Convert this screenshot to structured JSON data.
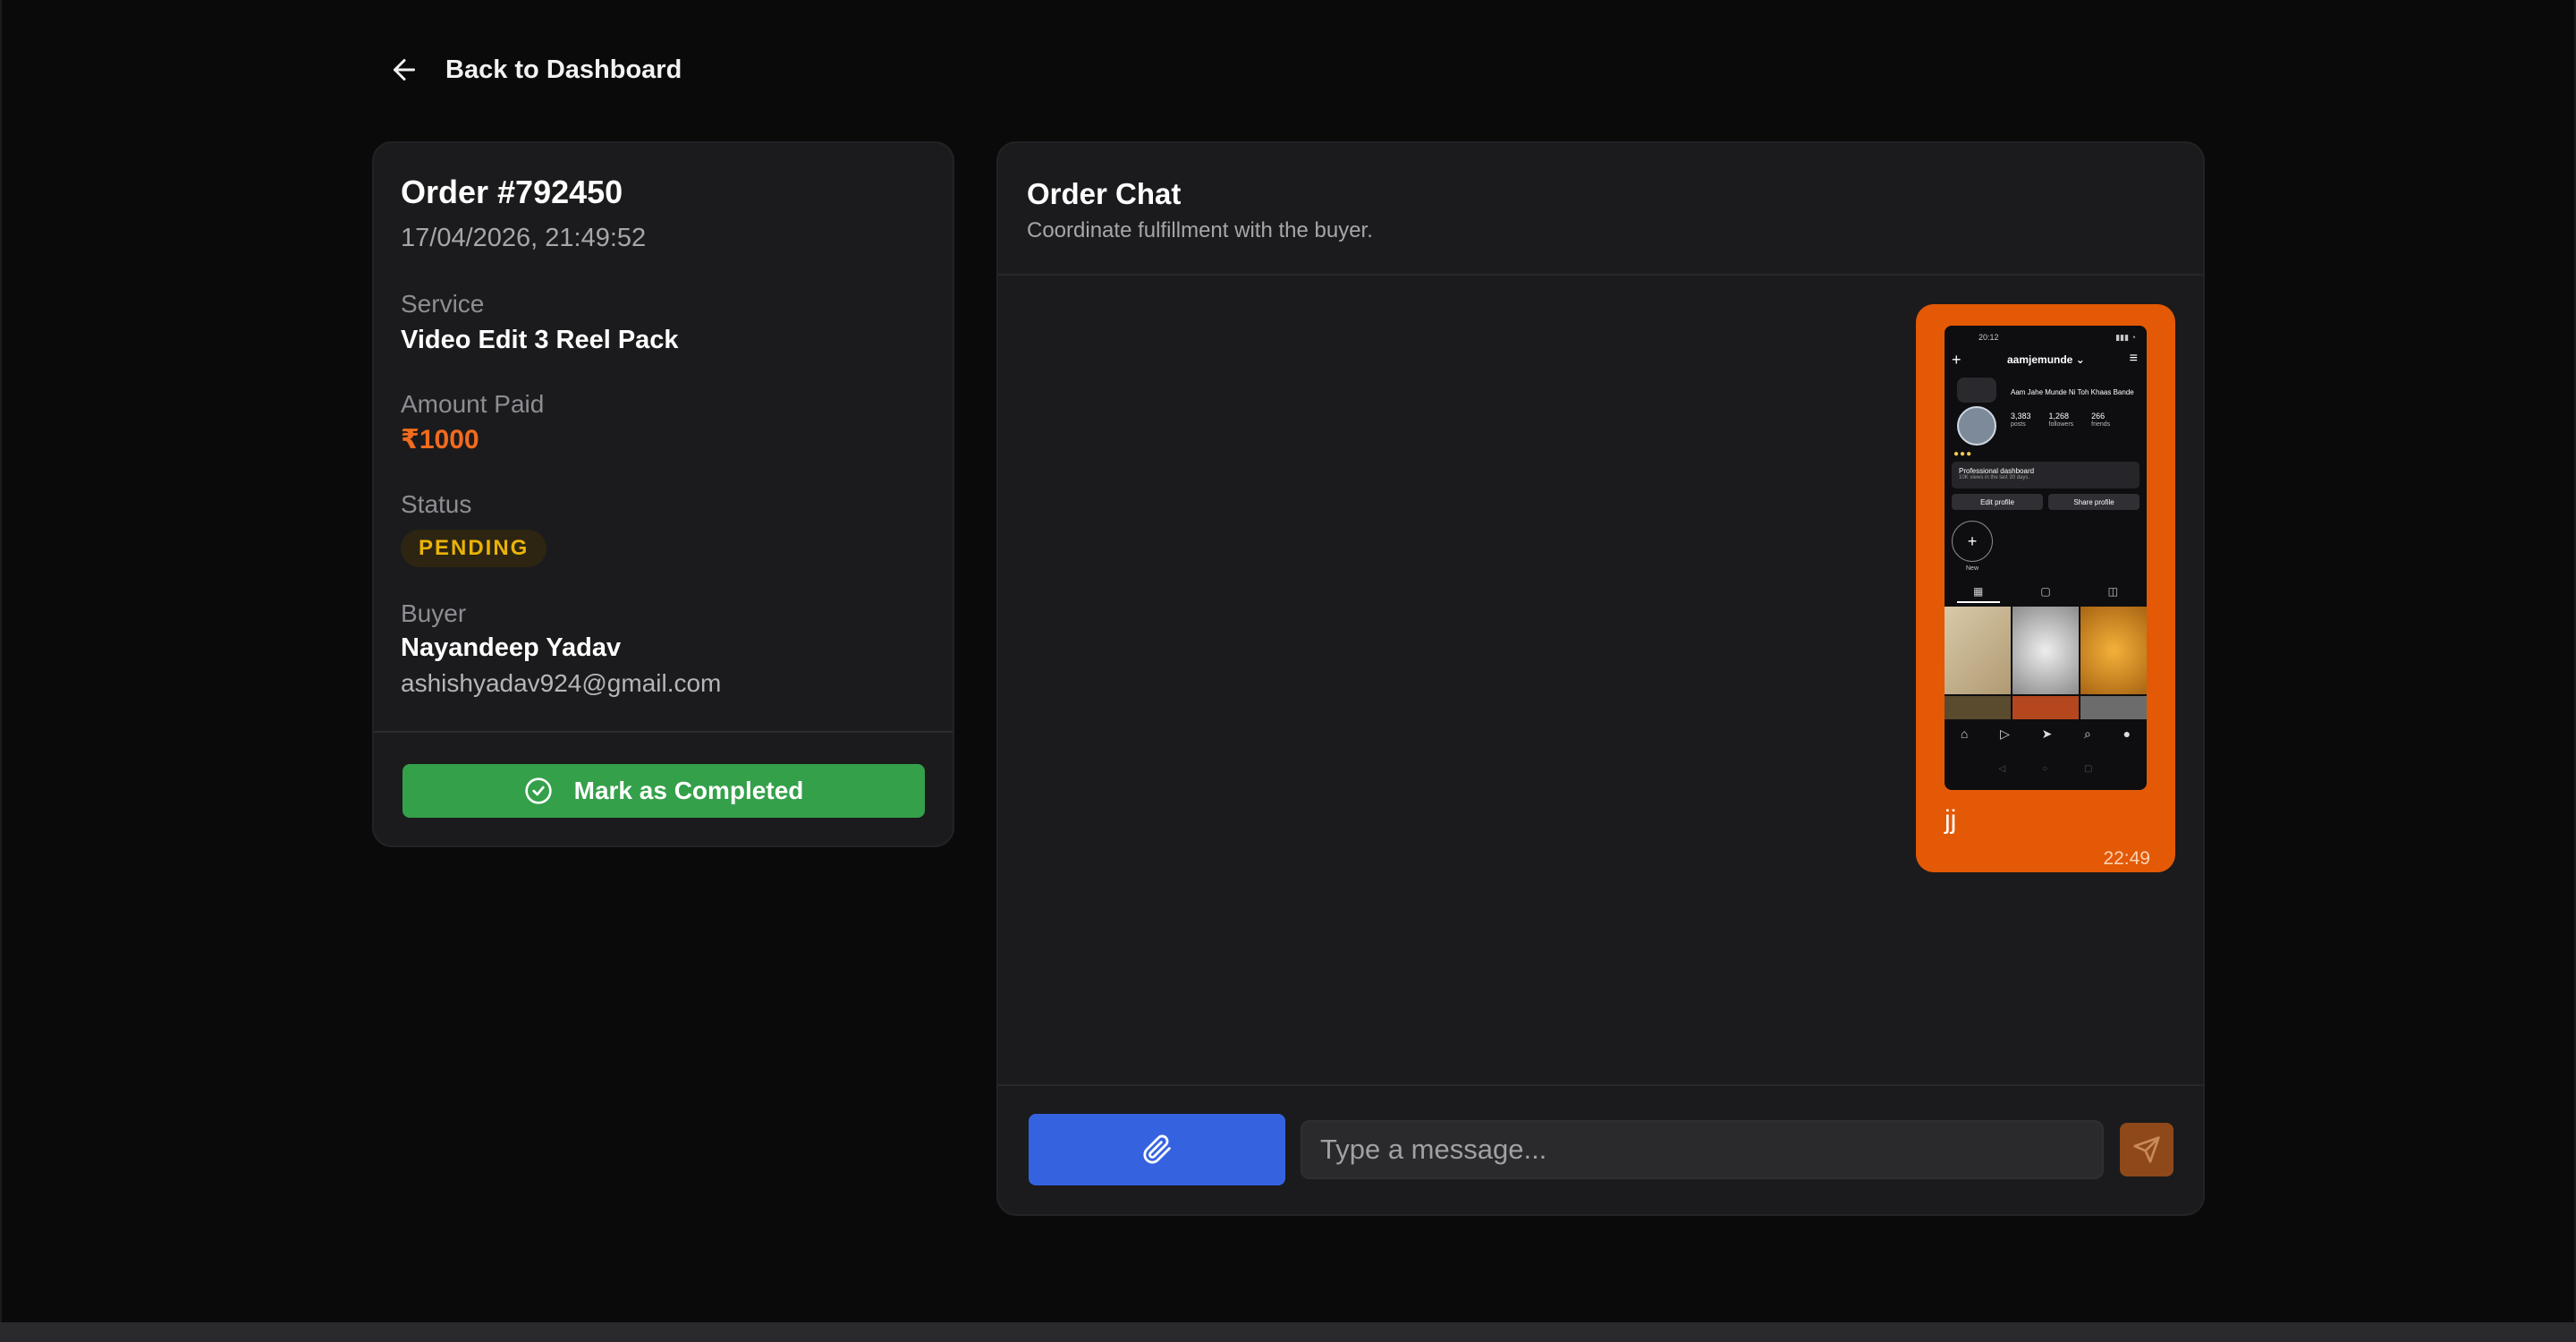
{
  "nav": {
    "back_label": "Back to Dashboard",
    "back_icon": "arrow-left-icon"
  },
  "order": {
    "title": "Order #792450",
    "date": "17/04/2026, 21:49:52",
    "service_label": "Service",
    "service_value": "Video Edit 3 Reel Pack",
    "amount_label": "Amount Paid",
    "amount_value": "₹1000",
    "status_label": "Status",
    "status_value": "PENDING",
    "buyer_label": "Buyer",
    "buyer_name": "Nayandeep Yadav",
    "buyer_email": "ashishyadav924@gmail.com",
    "complete_button": "Mark as Completed",
    "complete_icon": "check-circle-icon"
  },
  "chat": {
    "title": "Order Chat",
    "subtitle": "Coordinate fulfillment with the buyer.",
    "messages": [
      {
        "text": "jj",
        "time": "22:49",
        "attachment": {
          "status_time": "20:12",
          "username": "aamjemunde ⌄",
          "profile_name": "Aam Jahe Munde Ni Toh Khaas Bande",
          "stats": [
            {
              "value": "3,383",
              "label": "posts"
            },
            {
              "value": "1,268",
              "label": "followers"
            },
            {
              "value": "266",
              "label": "friends"
            }
          ],
          "dashboard_title": "Professional dashboard",
          "dashboard_sub": "10K views in the last 30 days.",
          "edit_profile": "Edit profile",
          "share_profile": "Share profile",
          "new_label": "New"
        }
      }
    ],
    "input_placeholder": "Type a message...",
    "attach_icon": "paperclip-icon",
    "send_icon": "send-icon"
  },
  "colors": {
    "accent": "#e35905",
    "success": "#34a04a",
    "attach": "#3563e0",
    "pending": "#eab308"
  }
}
